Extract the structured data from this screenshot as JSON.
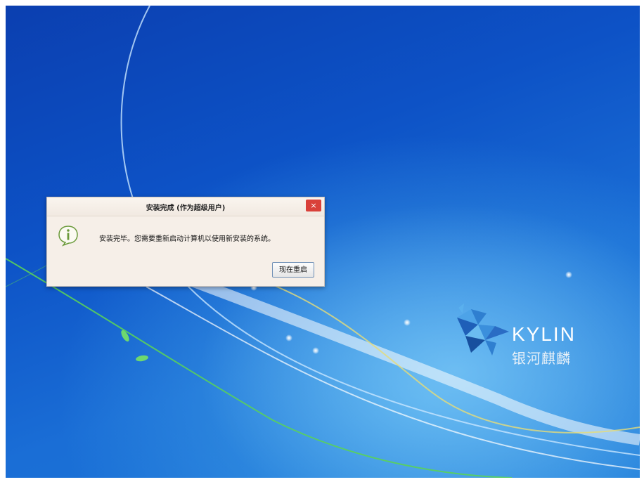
{
  "desktop": {
    "logo": {
      "text_en": "KYLIN",
      "text_cn": "银河麒麟"
    }
  },
  "dialog": {
    "title": "安装完成 (作为超级用户)",
    "close_label": "×",
    "icon": "info-icon",
    "message": "安装完毕。您需要重新启动计算机以使用新安装的系统。",
    "restart_button_label": "现在重启"
  },
  "colors": {
    "desktop_blue": "#0d52c6",
    "dialog_bg": "#f6efe8",
    "close_red": "#d9403a",
    "icon_green": "#6a9a3a"
  }
}
